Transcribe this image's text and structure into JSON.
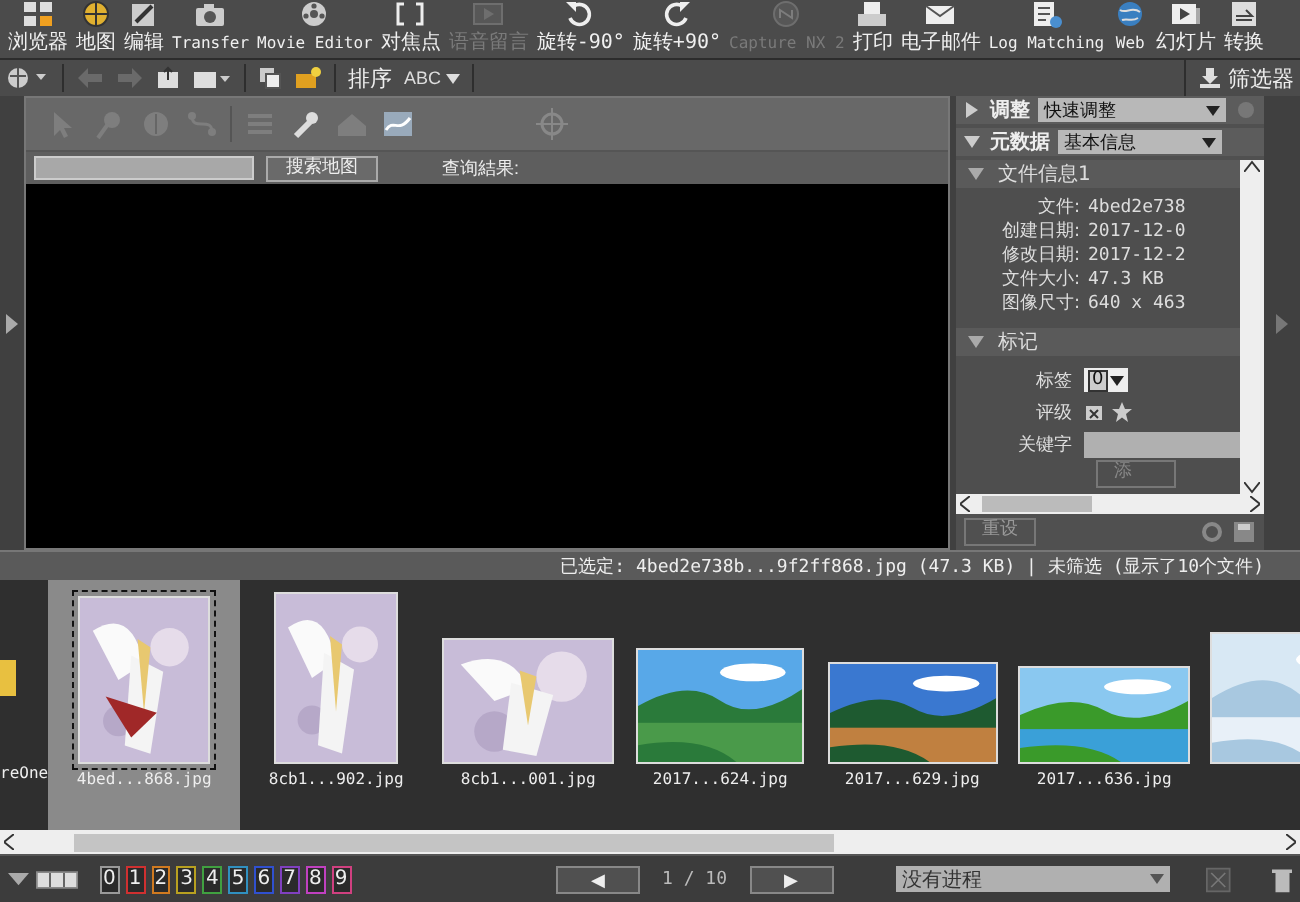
{
  "toolbar": {
    "items": [
      {
        "label": "浏览器",
        "disabled": false
      },
      {
        "label": "地图",
        "disabled": false
      },
      {
        "label": "编辑",
        "disabled": false
      },
      {
        "label": "Transfer",
        "disabled": false
      },
      {
        "label": "Movie Editor",
        "disabled": false
      },
      {
        "label": "对焦点",
        "disabled": false
      },
      {
        "label": "语音留言",
        "disabled": true
      },
      {
        "label": "旋转-90°",
        "disabled": false
      },
      {
        "label": "旋转+90°",
        "disabled": false
      },
      {
        "label": "Capture NX 2",
        "disabled": true
      },
      {
        "label": "打印",
        "disabled": false
      },
      {
        "label": "电子邮件",
        "disabled": false
      },
      {
        "label": "Log Matching",
        "disabled": false
      },
      {
        "label": "Web",
        "disabled": false
      },
      {
        "label": "幻灯片",
        "disabled": false
      },
      {
        "label": "转换",
        "disabled": false
      }
    ]
  },
  "subtoolbar": {
    "sort_label": "排序",
    "sort_value": "ABC",
    "filter_button": "筛选器"
  },
  "map": {
    "search_button": "搜索地图",
    "results_label": "查询結果:"
  },
  "side_panel": {
    "adjust": {
      "label": "调整",
      "value": "快速调整",
      "expanded": false
    },
    "metadata": {
      "label": "元数据",
      "value": "基本信息",
      "expanded": true
    },
    "file_info": {
      "title": "文件信息1",
      "expanded": true,
      "fields": [
        {
          "label": "文件:",
          "value": "4bed2e738"
        },
        {
          "label": "创建日期:",
          "value": "2017-12-0"
        },
        {
          "label": "修改日期:",
          "value": "2017-12-2"
        },
        {
          "label": "文件大小:",
          "value": "47.3 KB"
        },
        {
          "label": "图像尺寸:",
          "value": "640 x 463"
        }
      ]
    },
    "marks": {
      "title": "标记",
      "expanded": true,
      "label_field": {
        "label": "标签",
        "value": "0"
      },
      "rating_label": "评级",
      "keywords_label": "关键字",
      "add_button": "添"
    },
    "reset_button": "重设"
  },
  "status_bar": {
    "text": "已选定:  4bed2e738b...9f2ff868.jpg (47.3 KB) | 未筛选 (显示了10个文件)"
  },
  "filmstrip": {
    "folder": "reOne",
    "items": [
      {
        "caption": "4bed...868.jpg",
        "selected": true
      },
      {
        "caption": "8cb1...902.jpg",
        "selected": false
      },
      {
        "caption": "8cb1...001.jpg",
        "selected": false
      },
      {
        "caption": "2017...624.jpg",
        "selected": false
      },
      {
        "caption": "2017...629.jpg",
        "selected": false
      },
      {
        "caption": "2017...636.jpg",
        "selected": false
      },
      {
        "selected": false
      }
    ]
  },
  "bottom_bar": {
    "labels": [
      {
        "text": "0",
        "color": "#9a9a9a"
      },
      {
        "text": "1",
        "color": "#d03030"
      },
      {
        "text": "2",
        "color": "#d07a20"
      },
      {
        "text": "3",
        "color": "#b8a020"
      },
      {
        "text": "4",
        "color": "#40a040"
      },
      {
        "text": "5",
        "color": "#3090c0"
      },
      {
        "text": "6",
        "color": "#3050d0"
      },
      {
        "text": "7",
        "color": "#8040c0"
      },
      {
        "text": "8",
        "color": "#c040c0"
      },
      {
        "text": "9",
        "color": "#d04080"
      }
    ],
    "prev": "◀",
    "page": "1 / 10",
    "next": "▶",
    "process": "没有进程"
  }
}
